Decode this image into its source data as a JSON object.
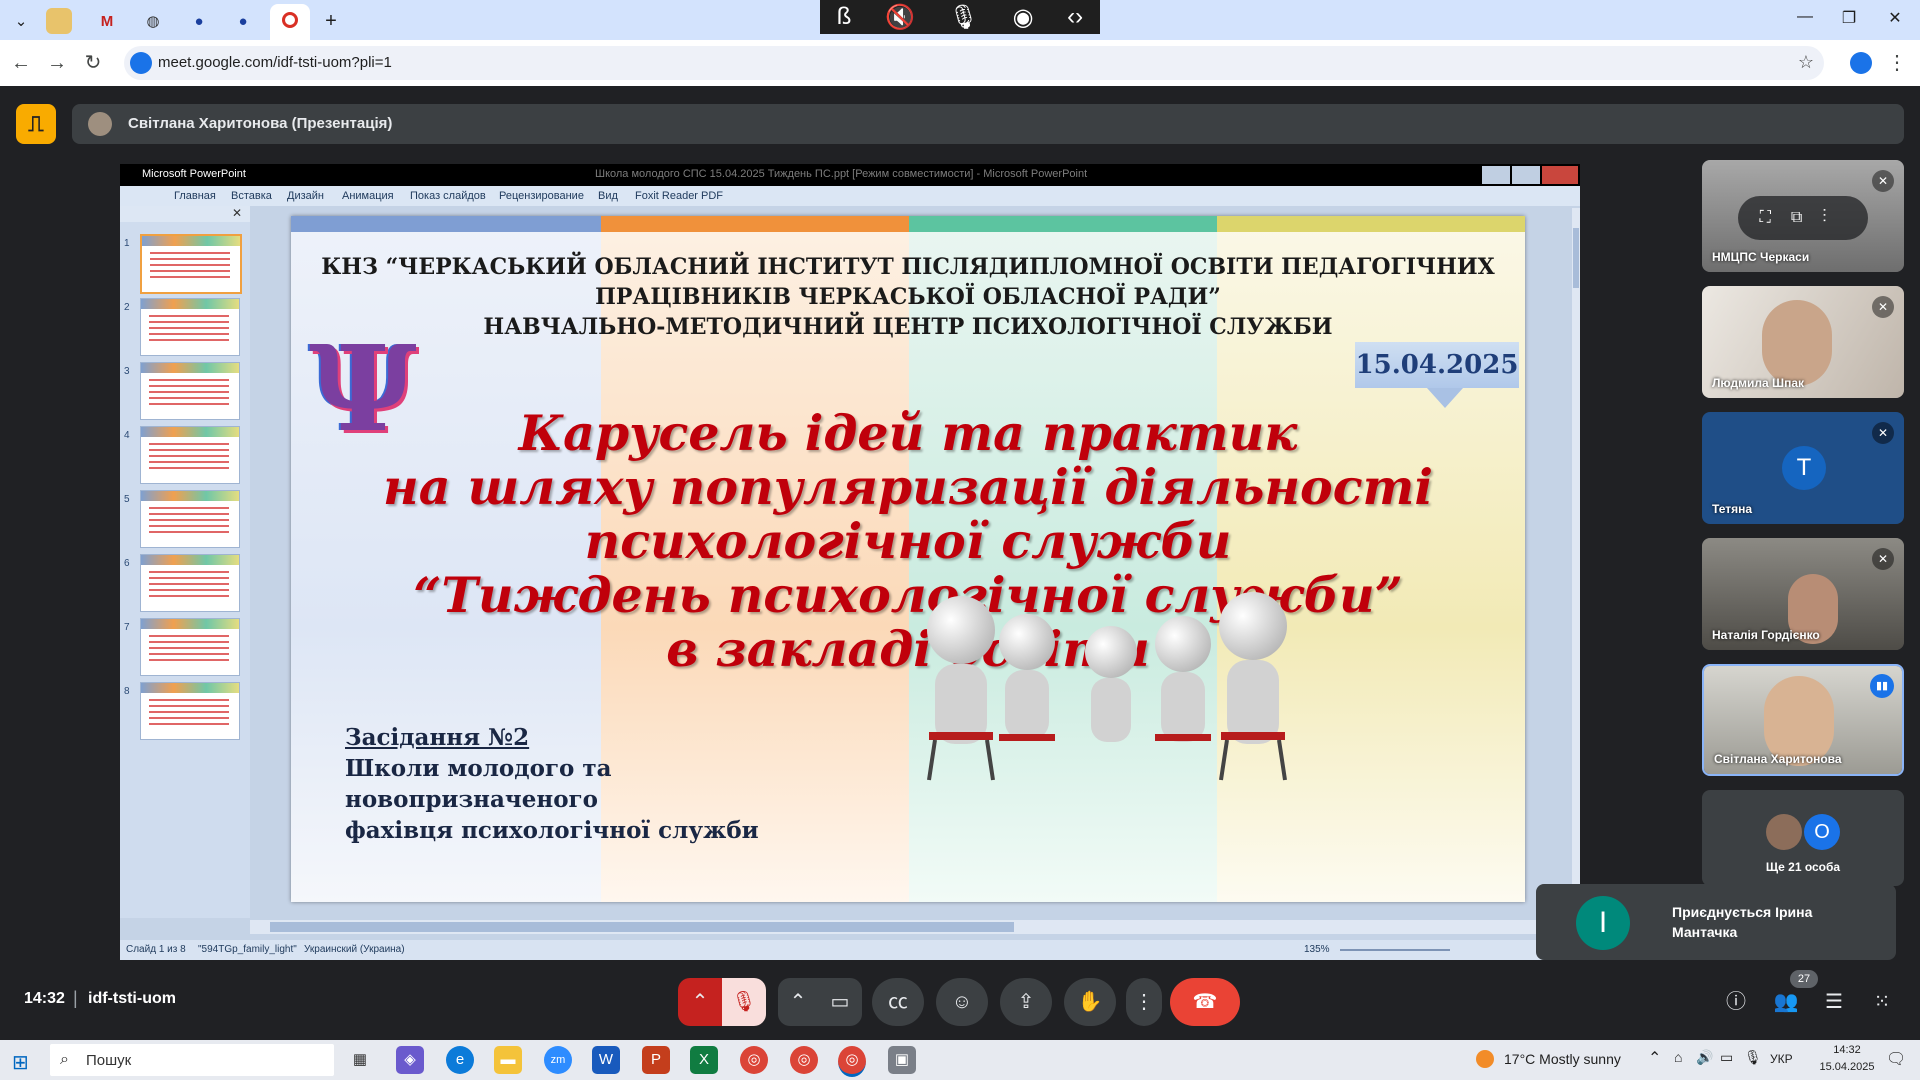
{
  "browser": {
    "url": "meet.google.com/idf-tsti-uom?pli=1"
  },
  "meet": {
    "presenter_label": "Світлана Харитонова (Презентація)",
    "meeting_time": "14:32",
    "meeting_code": "idf-tsti-uom",
    "participant_count": "27",
    "participants": [
      {
        "name": "НМЦПС Черкаси",
        "bg": "#8f8f8f"
      },
      {
        "name": "Людмила Шпак",
        "bg": "#c9c3bb"
      },
      {
        "name": "Тетяна",
        "initial": "T",
        "bg": "#1f4e87",
        "avatar_color": "#1565c0"
      },
      {
        "name": "Наталія Гордієнко",
        "bg": "#6d6a63"
      },
      {
        "name": "Світлана Харитонова",
        "bg": "#b8b7b0"
      }
    ],
    "others_label": "Ще 21 особа",
    "others_initial": "O",
    "toast_initial": "I",
    "toast_text": "Приєднується Ірина Мантачка"
  },
  "powerpoint": {
    "app_label": "Microsoft PowerPoint",
    "window_title": "Школа молодого СПС 15.04.2025 Тиждень ПС.ppt [Режим совместимости] - Microsoft PowerPoint",
    "ribbon_tabs": [
      "Главная",
      "Вставка",
      "Дизайн",
      "Анимация",
      "Показ слайдов",
      "Рецензирование",
      "Вид",
      "Foxit Reader PDF"
    ],
    "thumb_numbers": [
      "1",
      "2",
      "3",
      "4",
      "5",
      "6",
      "7",
      "8"
    ],
    "status": {
      "slide": "Слайд 1 из 8",
      "theme": "\"594TGp_family_light\"",
      "language": "Украинский (Украина)",
      "zoom": "135%"
    }
  },
  "slide": {
    "header_lines": [
      "КНЗ “ЧЕРКАСЬКИЙ ОБЛАСНИЙ ІНСТИТУТ ПІСЛЯДИПЛОМНОЇ ОСВІТИ ПЕДАГОГІЧНИХ",
      "ПРАЦІВНИКІВ ЧЕРКАСЬКОЇ ОБЛАСНОЇ РАДИ”",
      "НАВЧАЛЬНО-МЕТОДИЧНИЙ ЦЕНТР ПСИХОЛОГІЧНОЇ СЛУЖБИ"
    ],
    "date": "15.04.2025",
    "psi_symbol": "Ψ",
    "title_lines": [
      "Карусель ідей та практик",
      "на шляху популяризації діяльності",
      "психологічної служби",
      "“Тиждень психологічної служби”",
      "в закладі освіти"
    ],
    "meeting_lines": [
      "Засідання №2",
      "Школи молодого та",
      "новопризначеного",
      "фахівця психологічної служби"
    ]
  },
  "taskbar": {
    "search_placeholder": "Пошук",
    "weather": "17°C  Mostly sunny",
    "language": "УКР",
    "time": "14:32",
    "date": "15.04.2025"
  },
  "colors": {
    "meet_accent": "#f9ab00",
    "end_call": "#ea4335",
    "mic_off": "#f28b82",
    "title_red": "#c0000b"
  }
}
